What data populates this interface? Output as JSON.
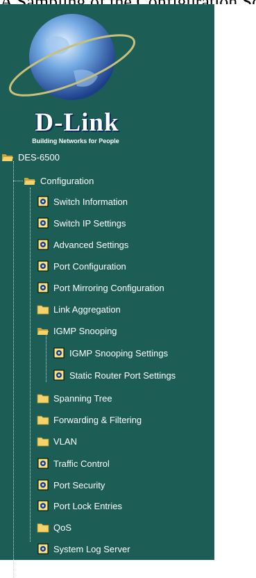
{
  "header": {
    "caption": "A Sampling of the Configuration Screens",
    "brand": "D-Link",
    "tagline": "Building Networks for People"
  },
  "tree": {
    "root": "DES-6500",
    "configuration": "Configuration",
    "items": [
      {
        "label": "Switch Information",
        "icon": "page-icon"
      },
      {
        "label": "Switch IP Settings",
        "icon": "page-icon"
      },
      {
        "label": "Advanced Settings",
        "icon": "page-icon"
      },
      {
        "label": "Port Configuration",
        "icon": "page-icon"
      },
      {
        "label": "Port Mirroring Configuration",
        "icon": "page-icon"
      },
      {
        "label": "Link Aggregation",
        "icon": "folder-icon"
      },
      {
        "label": "IGMP Snooping",
        "icon": "open-folder-icon"
      },
      {
        "label": "IGMP Snooping Settings",
        "icon": "page-icon"
      },
      {
        "label": "Static Router Port Settings",
        "icon": "page-icon"
      },
      {
        "label": "Spanning Tree",
        "icon": "folder-icon"
      },
      {
        "label": "Forwarding & Filtering",
        "icon": "folder-icon"
      },
      {
        "label": "VLAN",
        "icon": "folder-icon"
      },
      {
        "label": "Traffic Control",
        "icon": "page-icon"
      },
      {
        "label": "Port Security",
        "icon": "page-icon"
      },
      {
        "label": "Port Lock Entries",
        "icon": "page-icon"
      },
      {
        "label": "QoS",
        "icon": "folder-icon"
      },
      {
        "label": "System Log Server",
        "icon": "page-icon"
      }
    ]
  }
}
